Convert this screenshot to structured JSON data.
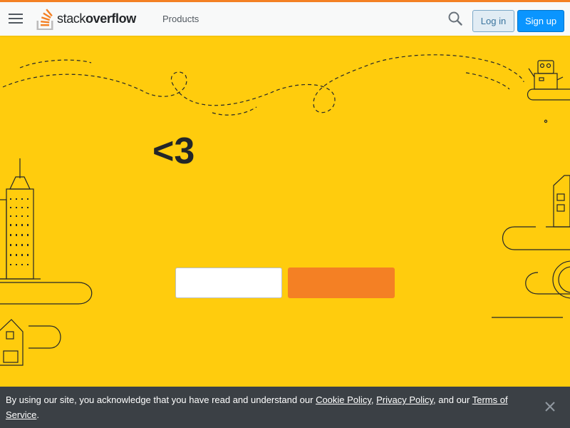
{
  "header": {
    "menu_icon": "hamburger-menu-icon",
    "logo": {
      "text_regular": "stack",
      "text_bold": "overflow",
      "icon": "stackoverflow-logo-icon"
    },
    "products_label": "Products",
    "search_icon": "search-icon",
    "login_label": "Log in",
    "signup_label": "Sign up"
  },
  "hero": {
    "title": "<3",
    "email_value": "",
    "cta_label": ""
  },
  "cookie_notice": {
    "prefix": "By using our site, you acknowledge that you have read and understand our ",
    "cookie_policy": "Cookie Policy",
    "sep1": ", ",
    "privacy_policy": "Privacy Policy",
    "sep2": ", and our ",
    "terms": "Terms of Service",
    "suffix": ".",
    "close_icon": "close-icon"
  },
  "colors": {
    "background": "#ffcc0d",
    "accent": "#f48024",
    "primary": "#0a95ff",
    "cookie_bg": "#3b4045"
  }
}
